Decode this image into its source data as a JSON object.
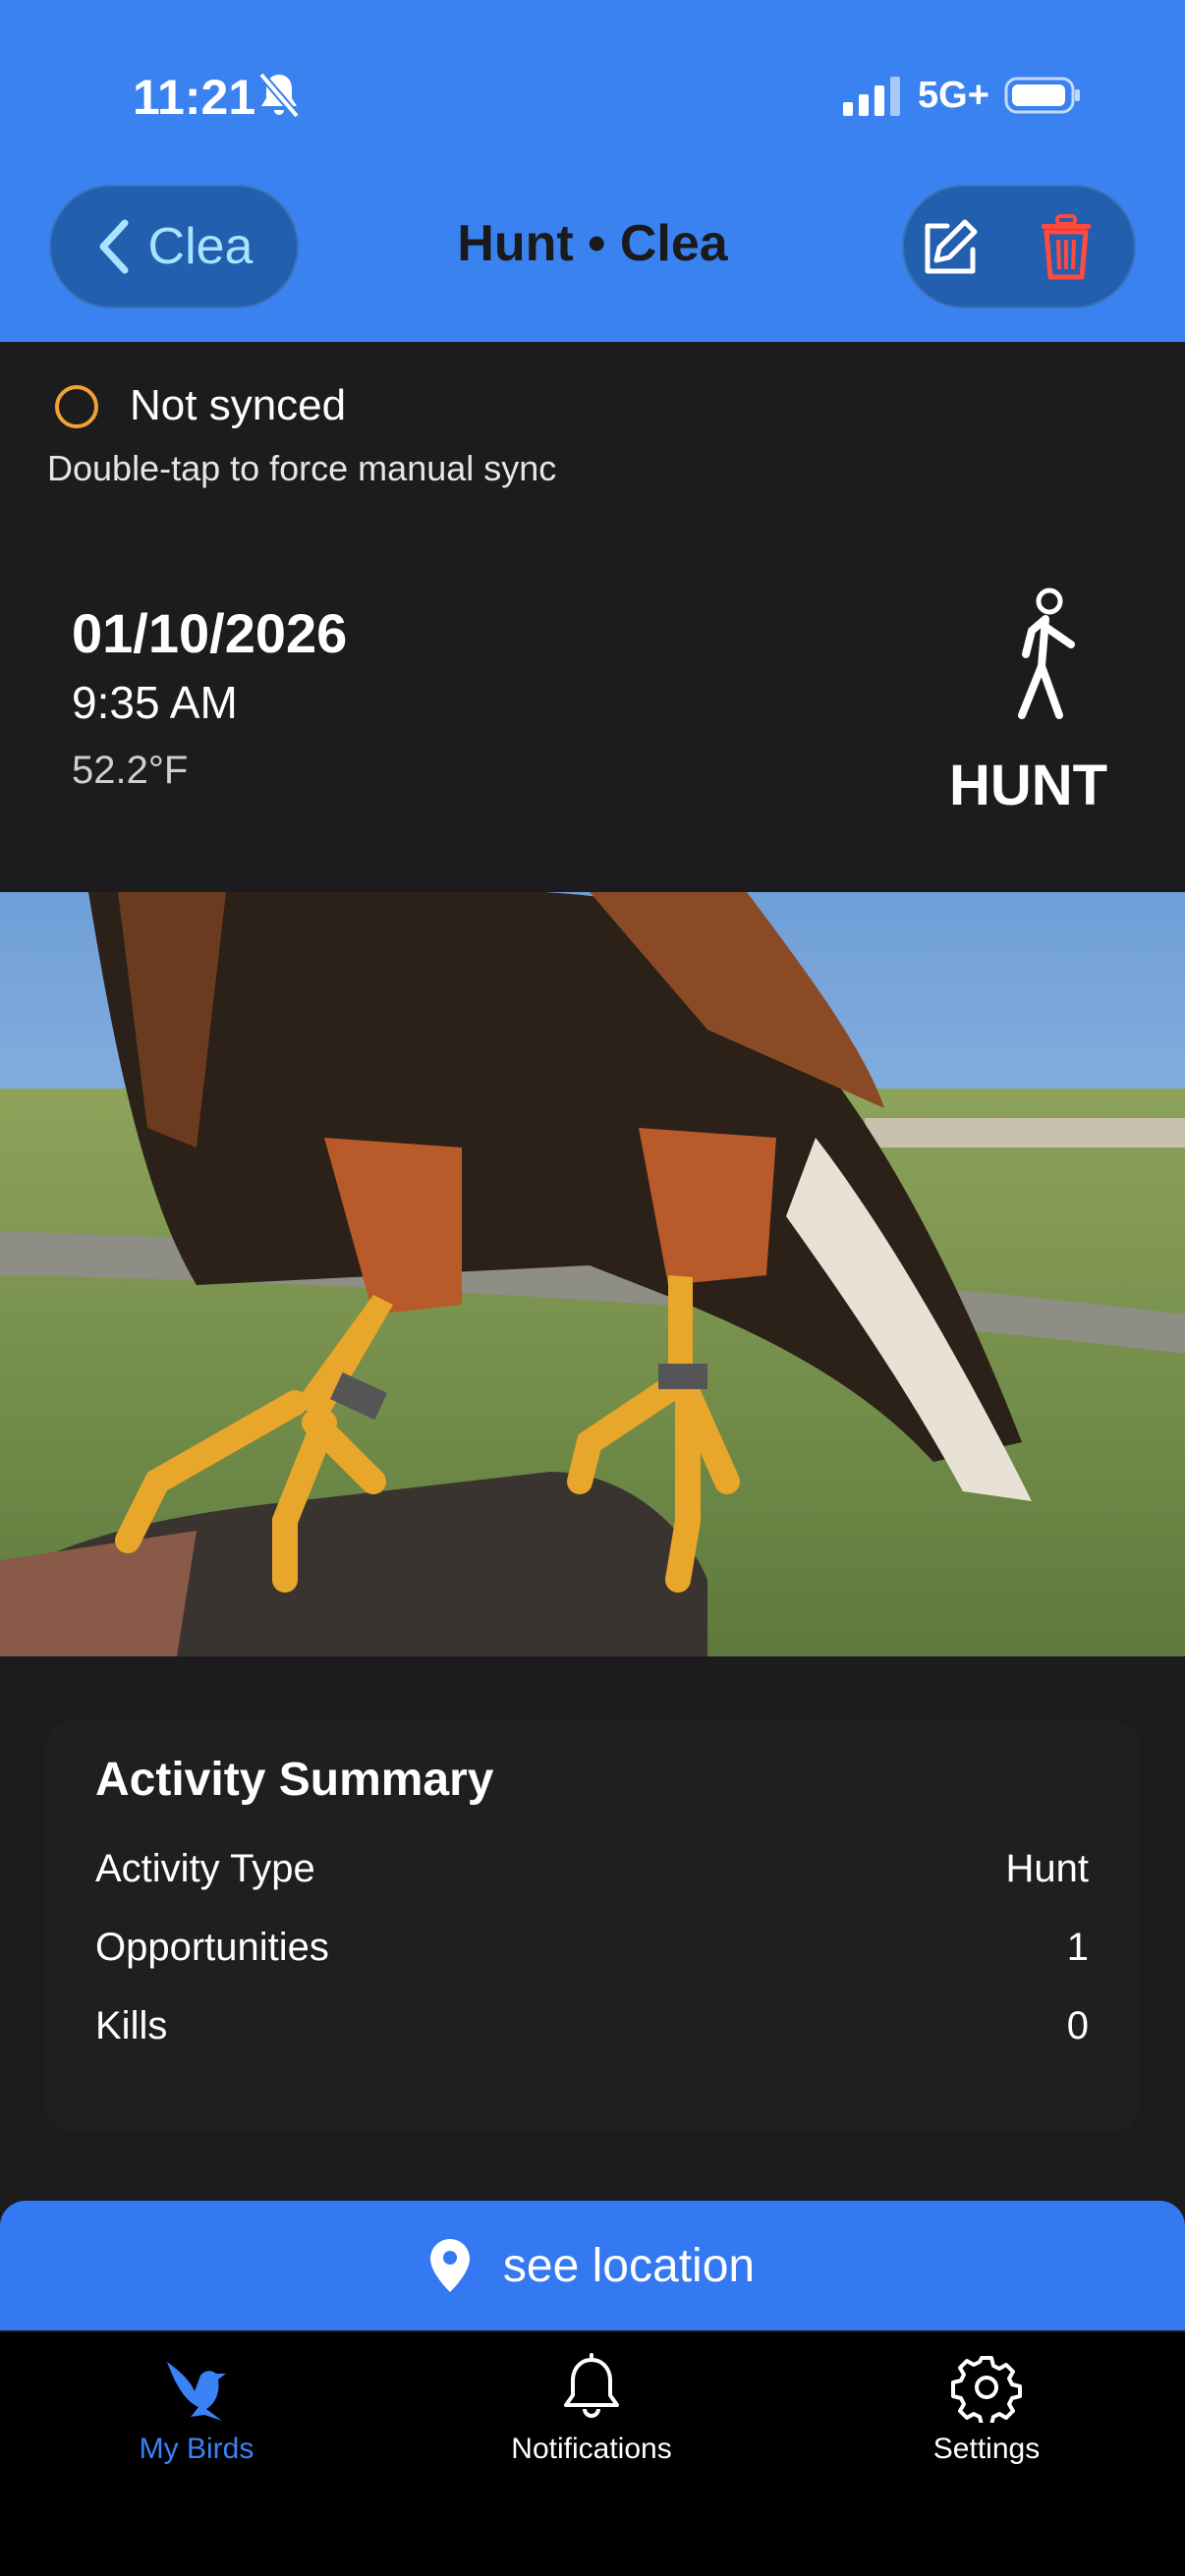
{
  "status_bar": {
    "time": "11:21",
    "network": "5G+"
  },
  "nav": {
    "back_label": "Clea",
    "title": "Hunt • Clea"
  },
  "sync": {
    "status": "Not synced",
    "hint": "Double-tap to force manual sync",
    "ring_color": "#f0a332"
  },
  "entry": {
    "date": "01/10/2026",
    "time": "9:35 AM",
    "temperature": "52.2°F",
    "activity_badge": "HUNT"
  },
  "summary": {
    "title": "Activity Summary",
    "rows": [
      {
        "label": "Activity Type",
        "value": "Hunt"
      },
      {
        "label": "Opportunities",
        "value": "1"
      },
      {
        "label": "Kills",
        "value": "0"
      }
    ]
  },
  "location_button": {
    "label": "see location"
  },
  "tabs": [
    {
      "label": "My Birds",
      "icon": "bird-icon",
      "active": true
    },
    {
      "label": "Notifications",
      "icon": "bell-icon",
      "active": false
    },
    {
      "label": "Settings",
      "icon": "gear-icon",
      "active": false
    }
  ],
  "colors": {
    "header": "#3a82f0",
    "accent": "#3478f2",
    "trash": "#ff4a3d",
    "tab_active": "#3b82f6"
  }
}
